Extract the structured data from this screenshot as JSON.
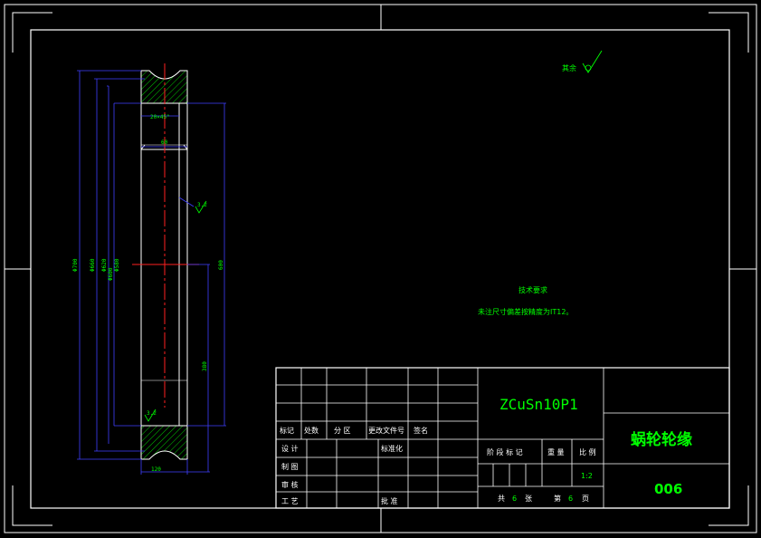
{
  "tech_req": {
    "title": "技术要求",
    "line1": "未注尺寸偏差按精度为IT12。"
  },
  "roughness_note": "其余",
  "dimensions": {
    "d1": "Φ700",
    "d2": "Φ660",
    "d3": "Φ620",
    "d4": "Φ600",
    "d5": "Φ580",
    "w1": "120",
    "w2": "60",
    "h1": "380",
    "h2": "600",
    "small1": "20×45°",
    "small2": "3.2",
    "small3": "3.2"
  },
  "title_block": {
    "material": "ZCuSn10P1",
    "part_name": "蜗轮轮缘",
    "drawing_no": "006",
    "rev_headers": {
      "mark": "标记",
      "count": "处数",
      "zone": "分 区",
      "doc_no": "更改文件号",
      "sign": "签名"
    },
    "roles": {
      "design": "设 计",
      "draw": "制 图",
      "review": "审 核",
      "process": "工 艺",
      "standard": "标准化",
      "approve": "批 准"
    },
    "stage_headers": {
      "stage": "阶 段 标 记",
      "weight": "重 量",
      "scale": "比 例"
    },
    "scale_value": "1:2",
    "sheets": {
      "total_label": "共",
      "total": "6",
      "total_unit": "张",
      "current_label": "第",
      "current": "6",
      "current_unit": "页"
    }
  },
  "colors": {
    "frame": "#ffffff",
    "dimension": "#3f3fff",
    "center": "#ff2020",
    "hatch": "#00c800",
    "text": "#00ff00"
  }
}
